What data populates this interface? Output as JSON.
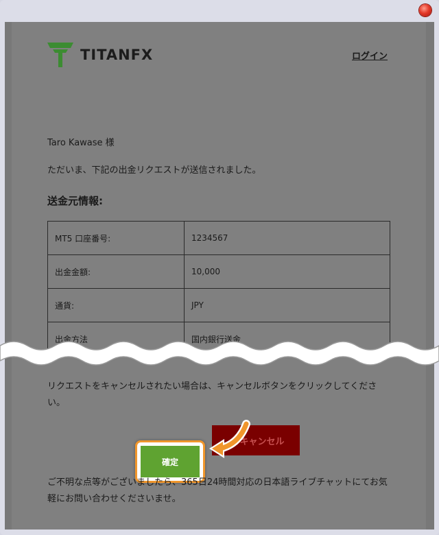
{
  "brand": {
    "logo_text": "TITANFX"
  },
  "header": {
    "login_label": "ログイン"
  },
  "email": {
    "greeting": "Taro Kawase 様",
    "message": "ただいま、下記の出金リクエストが送信されました。",
    "section_title": "送金元情報:",
    "rows": [
      {
        "label": "MT5 口座番号:",
        "value": "1234567"
      },
      {
        "label": "出金金額:",
        "value": "10,000"
      },
      {
        "label": "通貨:",
        "value": "JPY"
      },
      {
        "label": "出金方法",
        "value": "国内銀行送金"
      }
    ],
    "cancel_note": "リクエストをキャンセルされたい場合は、キャンセルボタンをクリックしてください。",
    "confirm_label": "確定",
    "cancel_label": "キャンセル",
    "footer": "ご不明な点等がございましたら、365日24時間対応の日本語ライブチャットにてお気軽にお問い合わせくださいませ。"
  },
  "colors": {
    "confirm_green": "#5fa331",
    "cancel_red": "#7a0000",
    "highlight_orange": "#f0962c",
    "logo_green": "#3c8c32"
  },
  "icons": {
    "window_control": "close-icon",
    "callout": "arrow-icon",
    "logo": "titanfx-logo-icon"
  }
}
